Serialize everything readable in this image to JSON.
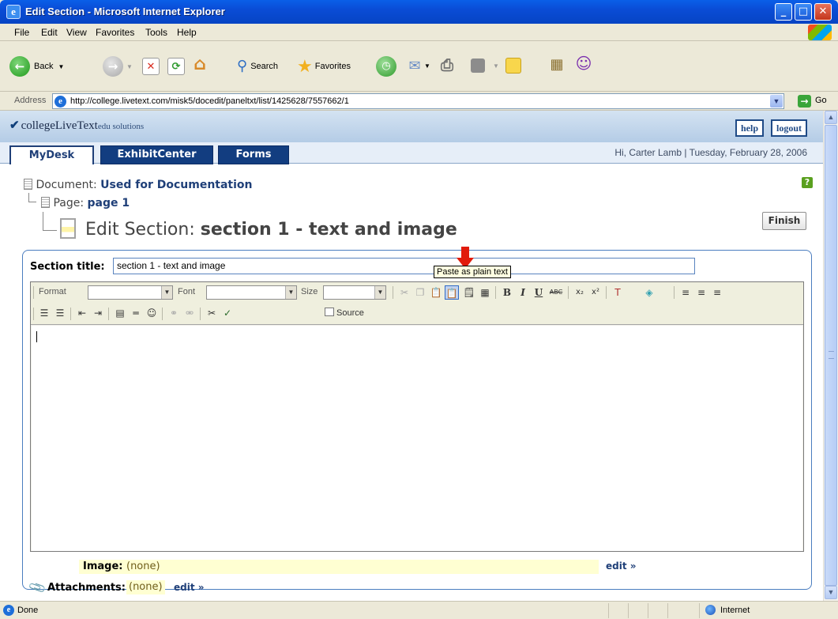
{
  "window": {
    "title": "Edit Section - Microsoft Internet Explorer",
    "minimize": "_",
    "maximize": "□",
    "close": "✕"
  },
  "menu": [
    "File",
    "Edit",
    "View",
    "Favorites",
    "Tools",
    "Help"
  ],
  "toolbar": {
    "back": "Back",
    "search": "Search",
    "favorites": "Favorites"
  },
  "address": {
    "label": "Address",
    "url": "http://college.livetext.com/misk5/docedit/paneltxt/list/1425628/7557662/1",
    "go": "Go"
  },
  "site": {
    "brand": "collegeLiveText",
    "brand_suffix": "edu solutions",
    "help": "help",
    "logout": "logout",
    "tabs": [
      "MyDesk",
      "ExhibitCenter",
      "Forms"
    ],
    "greeting": "Hi, Carter Lamb  |  Tuesday, February 28, 2006"
  },
  "breadcrumb": {
    "document_label": "Document:",
    "document_name": "Used for Documentation",
    "page_label": "Page:",
    "page_name": "page 1",
    "heading_prefix": "Edit Section:",
    "heading_name": "section 1 - text and image"
  },
  "finish": "Finish",
  "section": {
    "title_label": "Section title:",
    "title_value": "section 1 - text and image"
  },
  "editor": {
    "format_label": "Format",
    "font_label": "Font",
    "size_label": "Size",
    "source": "Source",
    "tooltip": "Paste as plain text"
  },
  "image": {
    "label": "Image:",
    "value": "(none)",
    "edit": "edit »"
  },
  "attachments": {
    "label": "Attachments:",
    "value": "(none)",
    "edit": "edit »"
  },
  "status": {
    "text": "Done",
    "zone": "Internet"
  },
  "colors": {
    "titlebar": "#0a4cd6",
    "nav_tab": "#123d80",
    "accent_link": "#1f3f78",
    "highlight": "#ffffd2",
    "arrow": "#e11b0c"
  }
}
